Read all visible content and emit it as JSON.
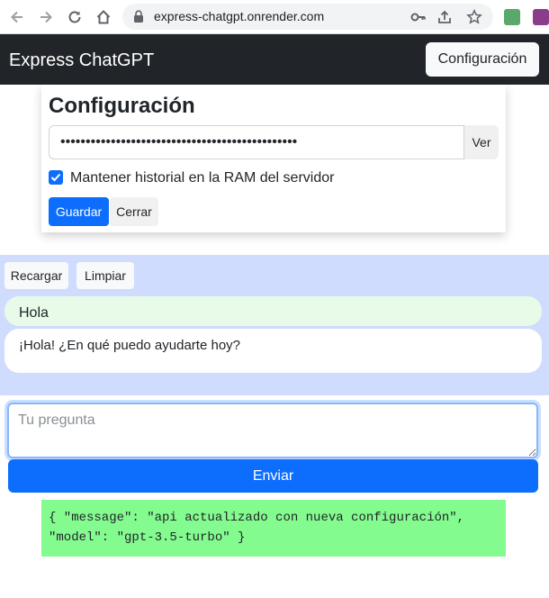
{
  "browser": {
    "url": "express-chatgpt.onrender.com"
  },
  "navbar": {
    "brand": "Express ChatGPT",
    "config_button": "Configuración"
  },
  "config": {
    "title": "Configuración",
    "api_key_value": "•••••••••••••••••••••••••••••••••••••••••••••••",
    "show_button": "Ver",
    "keep_history_label": "Mantener historial en la RAM del servidor",
    "keep_history_checked": true,
    "save_button": "Guardar",
    "close_button": "Cerrar"
  },
  "chat": {
    "reload_button": "Recargar",
    "clear_button": "Limpiar",
    "messages": [
      {
        "role": "user",
        "text": "Hola"
      },
      {
        "role": "assistant",
        "text": "¡Hola! ¿En qué puedo ayudarte hoy?"
      }
    ]
  },
  "composer": {
    "placeholder": "Tu pregunta",
    "value": "",
    "send_button": "Enviar"
  },
  "response": {
    "text": "{ \"message\": \"api actualizado con nueva configuración\",\n\"model\": \"gpt-3.5-turbo\" }"
  },
  "colors": {
    "navbar": "#212529",
    "primary": "#0d6efd",
    "chat_background": "#cfdcfe",
    "user_bubble": "#e8fbe9",
    "response_background": "#84fb8f"
  },
  "icons": [
    "back-icon",
    "forward-icon",
    "reload-icon",
    "home-icon",
    "lock-icon",
    "key-icon",
    "share-icon",
    "star-icon",
    "extension-icon",
    "checkmark-icon"
  ]
}
